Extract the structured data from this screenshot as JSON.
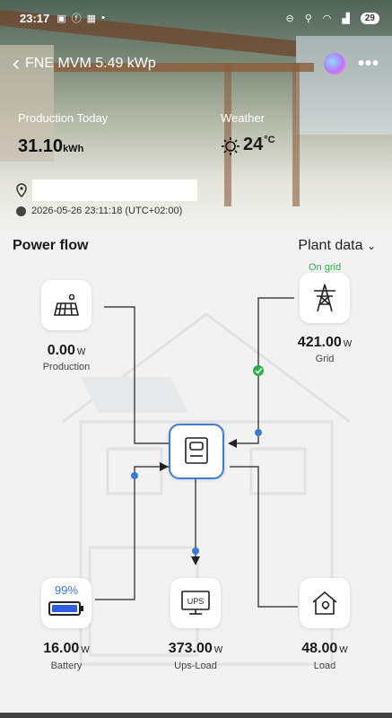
{
  "status_bar": {
    "time": "23:17",
    "battery": "29"
  },
  "header": {
    "title": "FNE MVM 5.49 kWp"
  },
  "production_today": {
    "label": "Production Today",
    "value": "31.10",
    "unit": "kWh"
  },
  "weather": {
    "label": "Weather",
    "temp": "24",
    "unit": "°C"
  },
  "timestamp": "2026-05-26 23:11:18 (UTC+02:00)",
  "power_flow": {
    "title": "Power flow",
    "plant_data_label": "Plant data",
    "production": {
      "value": "0.00",
      "unit": "W",
      "label": "Production"
    },
    "grid": {
      "value": "421.00",
      "unit": "W",
      "label": "Grid",
      "status": "On grid"
    },
    "battery": {
      "value": "16.00",
      "unit": "W",
      "label": "Battery",
      "percent": "99%",
      "level": 0.99
    },
    "ups_load": {
      "value": "373.00",
      "unit": "W",
      "label": "Ups-Load"
    },
    "load": {
      "value": "48.00",
      "unit": "W",
      "label": "Load"
    }
  },
  "icons": [
    "back-arrow-icon",
    "more-icon",
    "location-pin-icon",
    "clock-icon",
    "solar-panel-icon",
    "transmission-tower-icon",
    "inverter-icon",
    "battery-icon",
    "ups-icon",
    "home-load-icon",
    "check-icon",
    "sun-icon"
  ],
  "colors": {
    "accent": "#3c7ad6",
    "grid_ok": "#2eaf4a",
    "battery_fill": "#2f5fe0"
  }
}
